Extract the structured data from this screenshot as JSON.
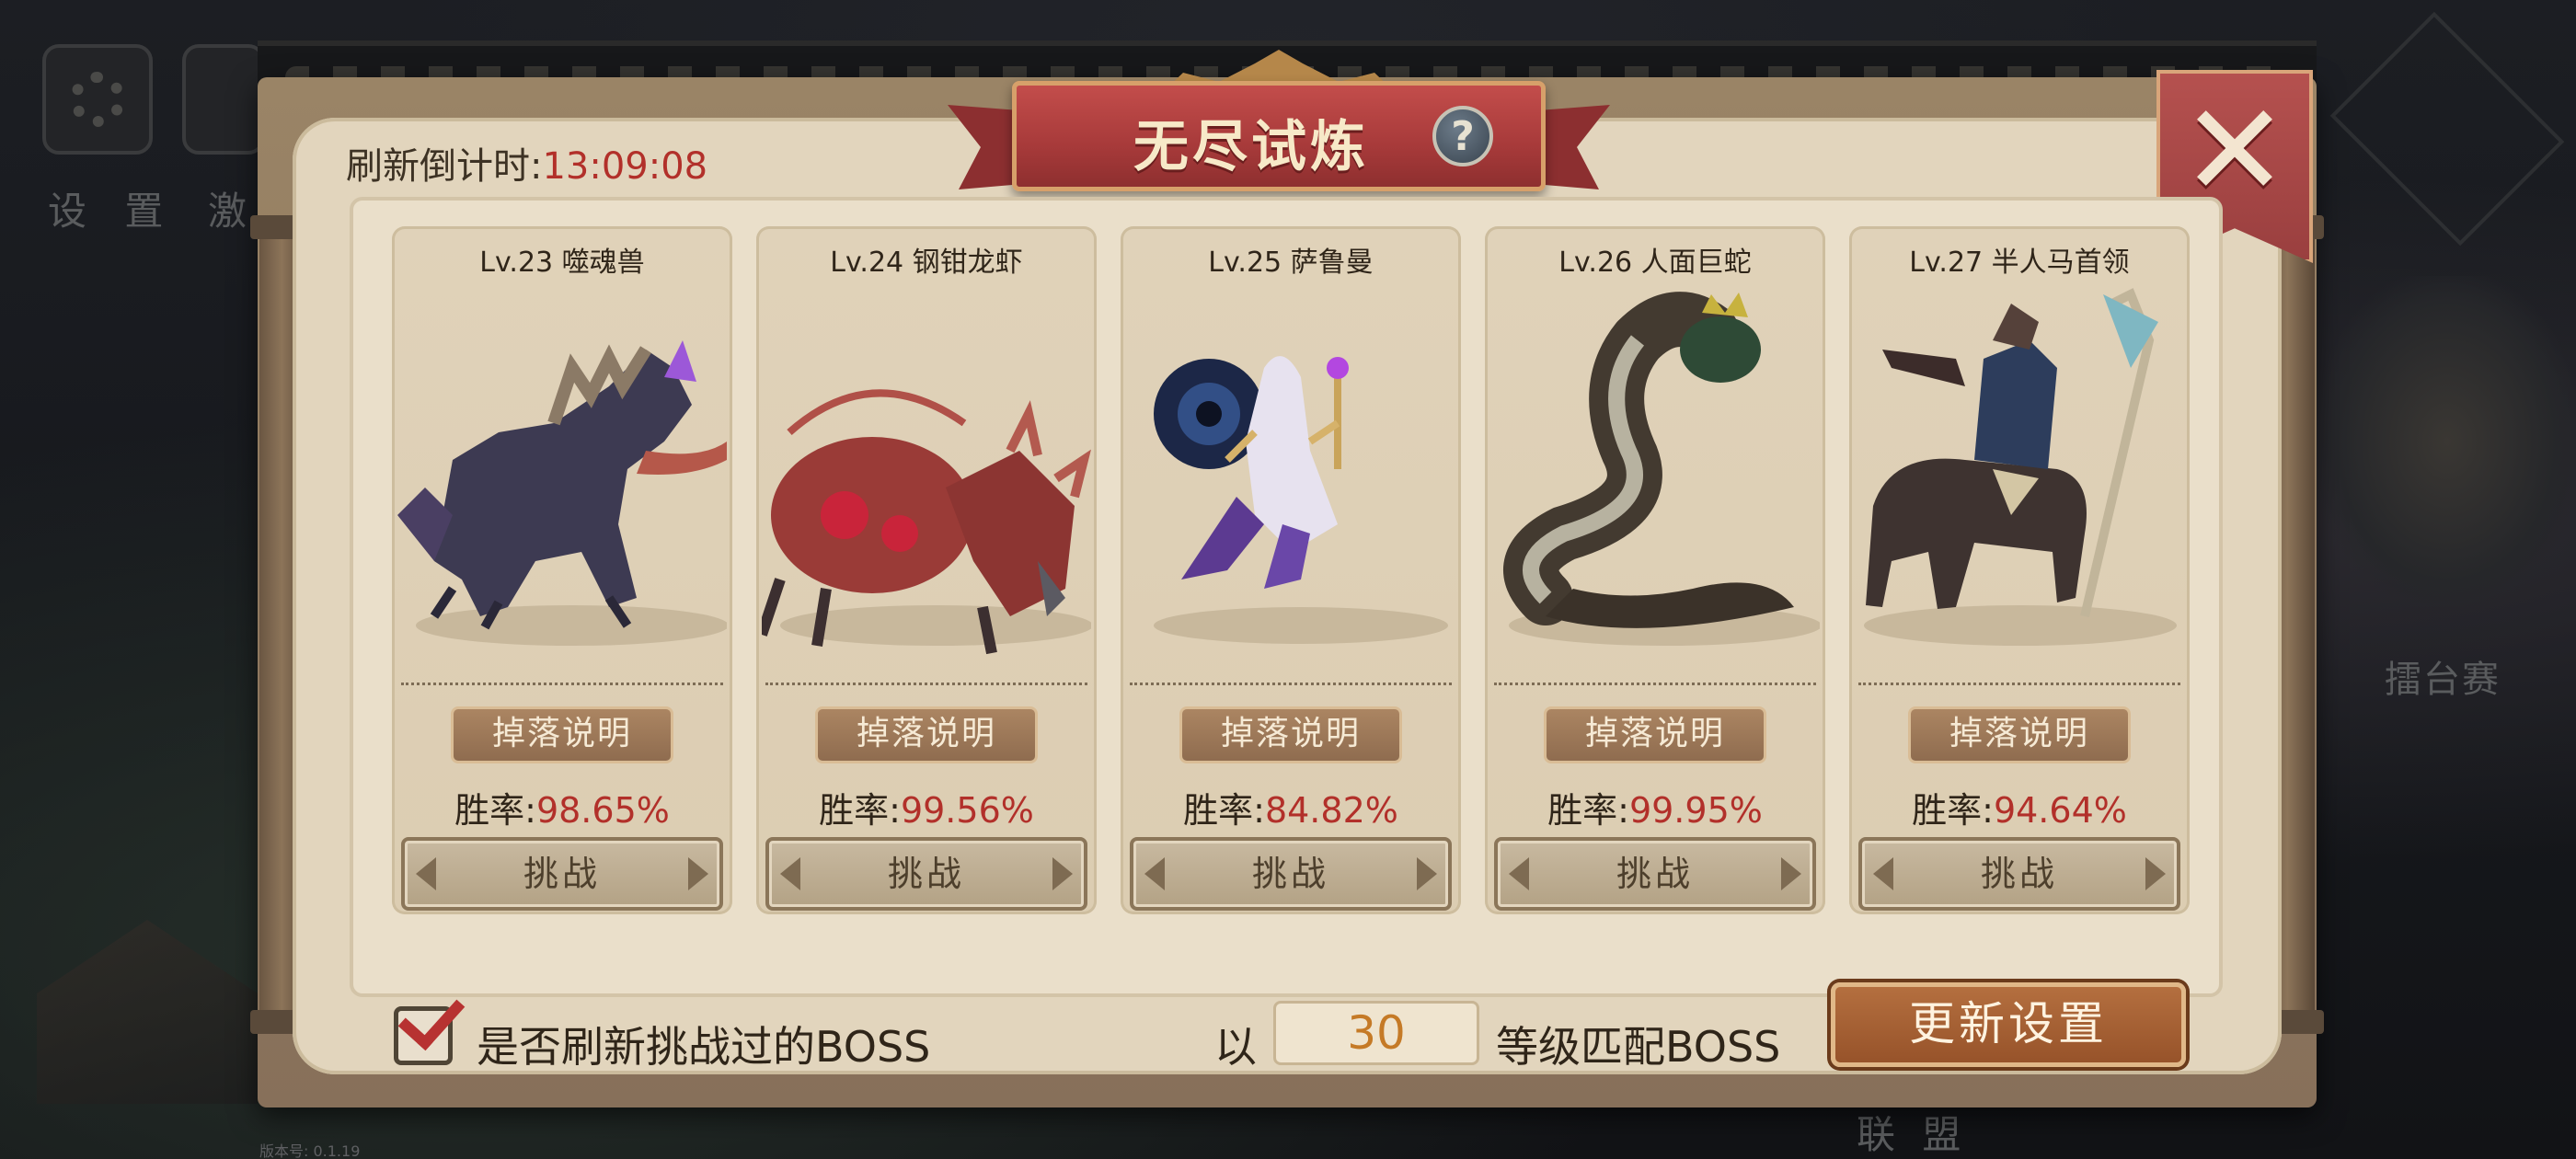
{
  "background": {
    "settings_label": "设 置",
    "partial_label": "激",
    "arena_label": "擂台赛",
    "alliance_label": "联 盟",
    "version_text": "版本号:  0.1.19"
  },
  "dialog": {
    "title": "无尽试炼",
    "help_icon": "?",
    "close_icon": "✕",
    "countdown_label": "刷新倒计时:",
    "countdown_time": "13:09:08"
  },
  "bosses": [
    {
      "name": "Lv.23 噬魂兽",
      "drop_label": "掉落说明",
      "winrate_label": "胜率:",
      "winrate": "98.65%",
      "challenge_label": "挑战",
      "art": "wolf-beast"
    },
    {
      "name": "Lv.24 钢钳龙虾",
      "drop_label": "掉落说明",
      "winrate_label": "胜率:",
      "winrate": "99.56%",
      "challenge_label": "挑战",
      "art": "lobster"
    },
    {
      "name": "Lv.25 萨鲁曼",
      "drop_label": "掉落说明",
      "winrate_label": "胜率:",
      "winrate": "84.82%",
      "challenge_label": "挑战",
      "art": "sorceress"
    },
    {
      "name": "Lv.26 人面巨蛇",
      "drop_label": "掉落说明",
      "winrate_label": "胜率:",
      "winrate": "99.95%",
      "challenge_label": "挑战",
      "art": "serpent"
    },
    {
      "name": "Lv.27 半人马首领",
      "drop_label": "掉落说明",
      "winrate_label": "胜率:",
      "winrate": "94.64%",
      "challenge_label": "挑战",
      "art": "centaur"
    }
  ],
  "footer": {
    "refresh_checkbox_checked": true,
    "refresh_label": "是否刷新挑战过的BOSS",
    "by_label": "以",
    "level_value": "30",
    "match_label": "等级匹配BOSS",
    "update_button_label": "更新设置"
  },
  "colors": {
    "accent_red": "#b2302a",
    "level_orange": "#c57a27",
    "panel_parchment": "#e2d5bd",
    "button_brown": "#97532a"
  }
}
